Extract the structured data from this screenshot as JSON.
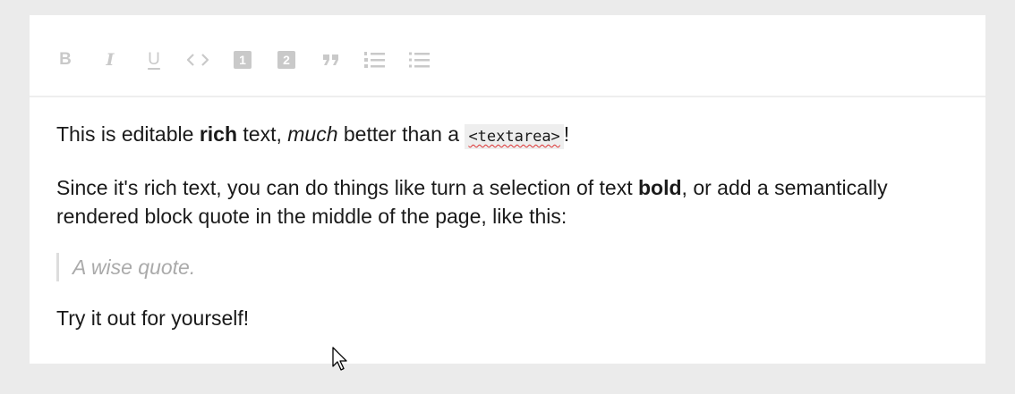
{
  "toolbar": {
    "bold_glyph": "B",
    "italic_glyph": "I",
    "underline_glyph": "U",
    "code_glyph": "<>",
    "heading_one": "1",
    "heading_two": "2",
    "quote_glyph": "”",
    "icon_color": "#c9c9c9"
  },
  "content": {
    "p1": {
      "t1": "This is editable ",
      "b1": "rich",
      "t2": " text, ",
      "i1": "much",
      "t3": " better than a ",
      "code": "<textarea>",
      "t4": "!"
    },
    "p2": {
      "t1": "Since it's rich text, you can do things like turn a selection of text ",
      "b1": "bold",
      "t2": ", or add a semantically rendered block quote in the middle of the page, like this:"
    },
    "quote": "A wise quote.",
    "p3": "Try it out for yourself!"
  }
}
